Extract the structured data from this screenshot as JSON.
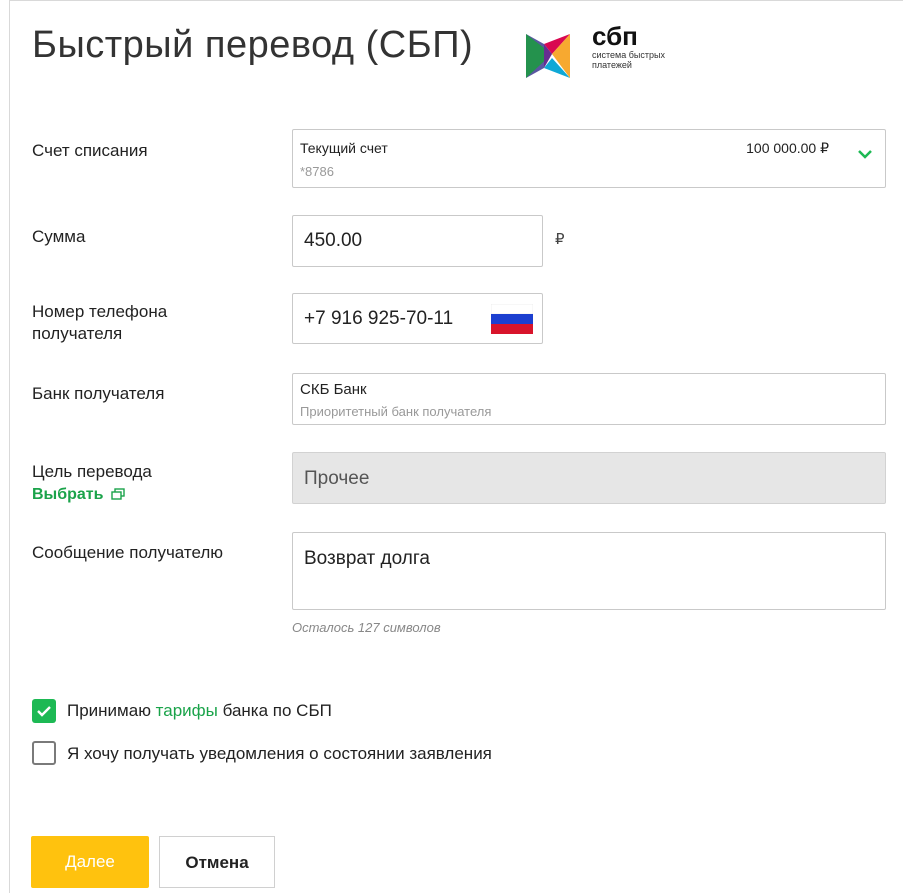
{
  "title": "Быстрый перевод (СБП)",
  "logo": {
    "word": "сбп",
    "subtitle": "система быстрых платежей",
    "icon": "sbp-logo-icon"
  },
  "account": {
    "label": "Счет списания",
    "name": "Текущий счет",
    "number": "*8786",
    "balance": "100 000.00 ₽",
    "icon": "chevron-down-icon"
  },
  "amount": {
    "label": "Сумма",
    "value": "450.00",
    "currency": "₽"
  },
  "phone": {
    "label_line1": "Номер телефона",
    "label_line2": "получателя",
    "value": "+7 916 925-70-11",
    "flag_icon": "russia-flag-icon"
  },
  "bank": {
    "label": "Банк получателя",
    "name": "СКБ Банк",
    "hint": "Приоритетный банк получателя"
  },
  "purpose": {
    "label": "Цель перевода",
    "link": "Выбрать",
    "link_icon": "external-window-icon",
    "value": "Прочее"
  },
  "message": {
    "label": "Сообщение получателю",
    "value": "Возврат долга",
    "counter": "Осталось 127 символов"
  },
  "agreement": {
    "before": "Принимаю ",
    "link": "тарифы",
    "after": " банка по СБП",
    "checked": true
  },
  "notifications": {
    "label": "Я хочу получать уведомления о состоянии заявления",
    "checked": false
  },
  "buttons": {
    "next": "Далее",
    "cancel": "Отмена"
  },
  "colors": {
    "accent_green": "#1db954",
    "link_green": "#1aa34a",
    "primary_button": "#ffc20e"
  }
}
